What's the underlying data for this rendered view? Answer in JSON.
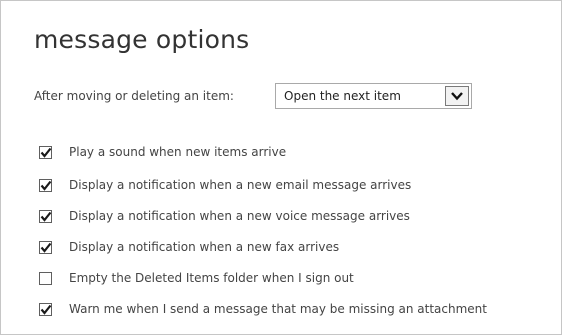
{
  "title": "message options",
  "after_move": {
    "label": "After moving or deleting an item:",
    "selected": "Open the next item"
  },
  "options": [
    {
      "label": "Play a sound when new items arrive",
      "checked": true
    },
    {
      "label": "Display a notification when a new email message arrives",
      "checked": true
    },
    {
      "label": "Display a notification when a new voice message arrives",
      "checked": true
    },
    {
      "label": "Display a notification when a new fax arrives",
      "checked": true
    },
    {
      "label": "Empty the Deleted Items folder when I sign out",
      "checked": false
    },
    {
      "label": "Warn me when I send a message that may be missing an attachment",
      "checked": true
    }
  ]
}
